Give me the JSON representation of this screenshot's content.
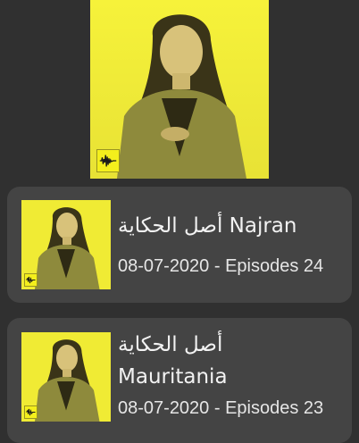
{
  "hero": {
    "artwork_icon": "podcast-cover-artwork",
    "brand_icon": "audio-waveform-logo"
  },
  "episodes": [
    {
      "title": "أصل الحكاية Najran",
      "date": "08-07-2020",
      "separator": " - ",
      "episodes_label": "Episodes 24"
    },
    {
      "title_line1": "أصل الحكاية",
      "title_line2": "Mauritania",
      "date": "08-07-2020",
      "separator": " - ",
      "episodes_label": "Episodes 23"
    }
  ],
  "colors": {
    "background": "#303030",
    "card": "#444444",
    "accent_yellow": "#f4ef1c"
  }
}
